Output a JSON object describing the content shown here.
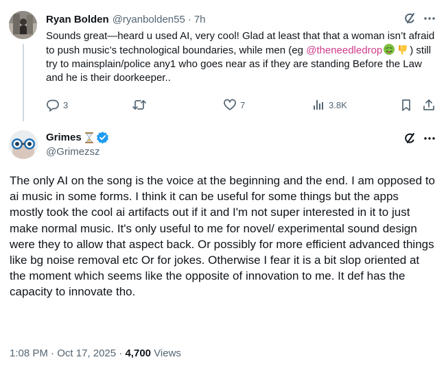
{
  "reply": {
    "author_name": "Ryan Bolden",
    "handle": "@ryanbolden55",
    "separator": "·",
    "time": "7h",
    "text_before": "Sounds great—heard u used AI, very cool! Glad at least that that a woman isn’t afraid to push music’s technological boundaries, while men (eg ",
    "mention": "@theneedledrop",
    "text_after": " still try to mainsplain/police any1 who goes near  as if they are standing Before the Law and he is their doorkeeper..",
    "emojis": [
      "nauseated-face-emoji",
      "thumbs-down-emoji"
    ],
    "paren_close": ")",
    "actions": {
      "replies": "3",
      "reposts": "",
      "likes": "7",
      "views": "3.8K"
    }
  },
  "main": {
    "author_name": "Grimes",
    "handle": "@Grimezsz",
    "verified": true,
    "name_emoji": "hourglass-emoji",
    "text": "The only AI on the song is the voice at the beginning and the end.  I am opposed to ai music in some forms.  I think it can be useful for some things but the apps mostly took the cool ai artifacts out if it and I'm not super interested in it to just make normal music.  It's only useful to me for novel/ experimental sound design were they to allow that aspect back.  Or possibly for more efficient advanced things like bg noise removal etc  Or for jokes.   Otherwise I fear it is a bit slop oriented at the moment which seems like the opposite of innovation to me.   It def has the capacity to innovate tho.",
    "time": "1:08 PM",
    "date": "Oct 17, 2025",
    "views_count": "4,700",
    "views_label": "Views",
    "meta_sep": "·"
  },
  "colors": {
    "text": "#0f1419",
    "secondary": "#536471",
    "mention": "#d03b8a",
    "verified": "#1d9bf0",
    "thread_line": "#cfd9de"
  }
}
